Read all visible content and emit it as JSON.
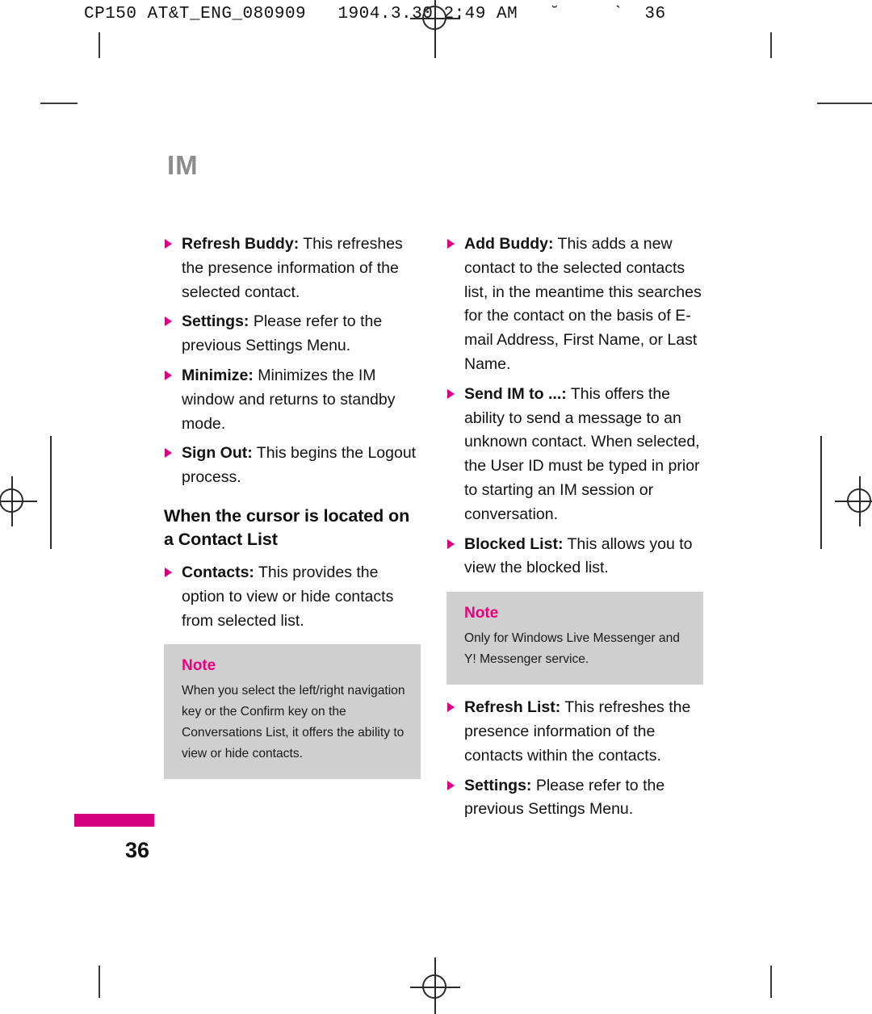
{
  "printer_header": "CP150 AT&T_ENG_080909   1904.3.30 2:49 AM   ˘     `  36",
  "chapter": {
    "title": "IM"
  },
  "left_column": {
    "bullets": [
      {
        "label": "Refresh Buddy:",
        "text": " This refreshes the presence information of the selected contact."
      },
      {
        "label": "Settings:",
        "text": " Please refer to the previous Settings Menu."
      },
      {
        "label": "Minimize:",
        "text": " Minimizes the IM window and returns to standby mode."
      },
      {
        "label": "Sign Out:",
        "text": " This begins the Logout process."
      }
    ],
    "section_heading": "When the cursor is located on a Contact List",
    "bullets_after_heading": [
      {
        "label": "Contacts:",
        "text": " This provides the option to view or hide contacts from selected list."
      }
    ],
    "note": {
      "title": "Note",
      "text": "When you select the left/right navigation key or the Confirm key on the Conversations List, it offers the ability to view or hide contacts."
    }
  },
  "right_column": {
    "bullets_top": [
      {
        "label": "Add Buddy:",
        "text": " This adds a new contact to the selected contacts list, in the meantime this searches for the contact on the basis of E-mail Address, First Name, or Last Name."
      },
      {
        "label": "Send IM to ...:",
        "text": " This offers the ability to send a message to an unknown contact. When selected, the User ID must be typed in prior to starting an IM session or conversation."
      },
      {
        "label": "Blocked List:",
        "text": " This allows you to view the blocked list."
      }
    ],
    "note": {
      "title": "Note",
      "text": "Only for Windows Live Messenger and Y! Messenger service."
    },
    "bullets_bottom": [
      {
        "label": "Refresh List:",
        "text": " This refreshes the presence information of the contacts within the contacts."
      },
      {
        "label": "Settings:",
        "text": " Please refer to the previous Settings Menu."
      }
    ]
  },
  "footer": {
    "page_number": "36"
  },
  "colors": {
    "accent_magenta": "#d4007f",
    "note_title_magenta": "#e8007d",
    "note_background": "#cfcfcf",
    "chapter_gray": "#8c8c8c"
  }
}
